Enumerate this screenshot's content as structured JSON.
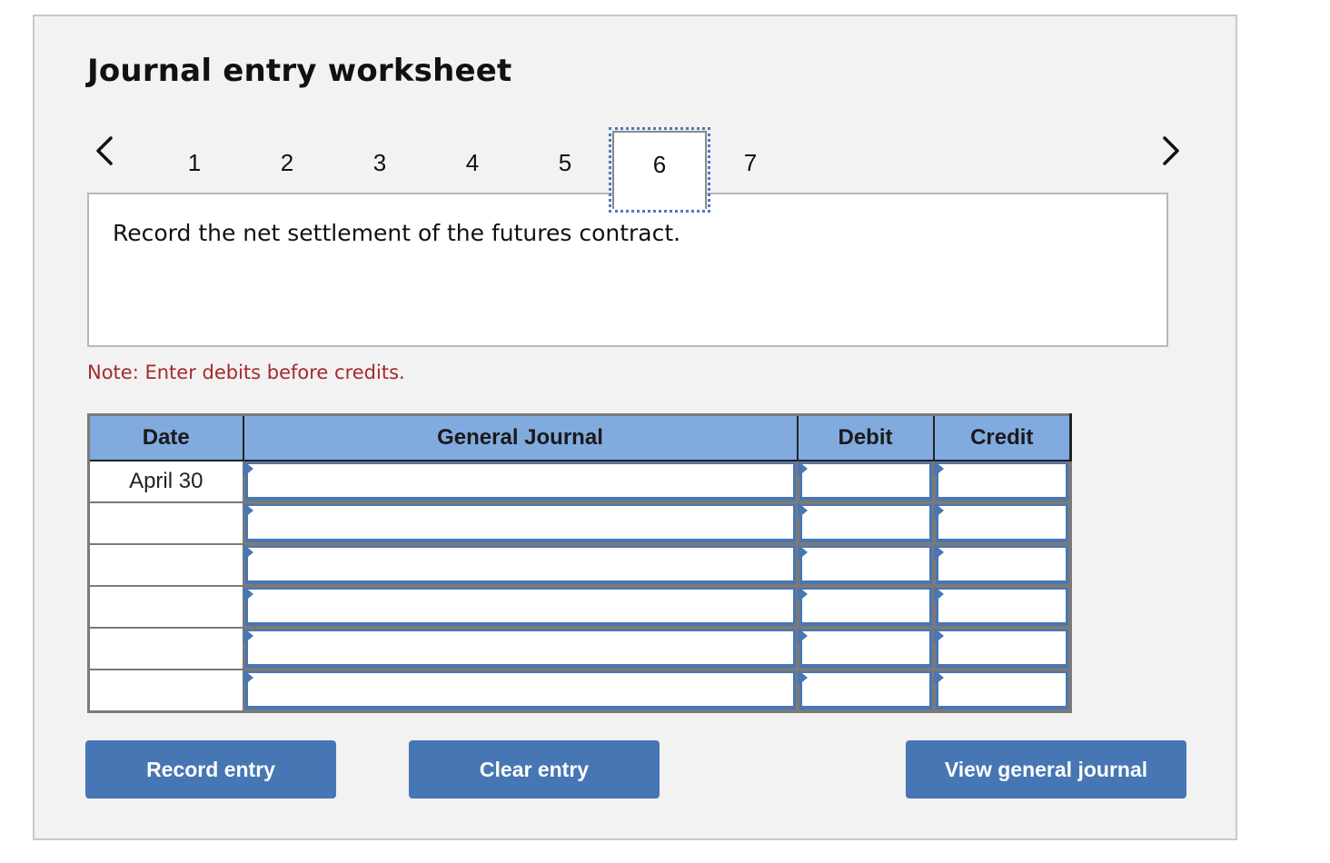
{
  "worksheet": {
    "title": "Journal entry worksheet",
    "navigation": {
      "prev_icon": "chevron-left-icon",
      "next_icon": "chevron-right-icon",
      "steps": [
        "1",
        "2",
        "3",
        "4",
        "5",
        "6",
        "7"
      ],
      "active_step": "6"
    },
    "prompt": "Record the net settlement of the futures contract.",
    "note": "Note: Enter debits before credits.",
    "table": {
      "columns": [
        "Date",
        "General Journal",
        "Debit",
        "Credit"
      ],
      "rows": [
        {
          "date": "April 30",
          "account": "",
          "debit": "",
          "credit": ""
        },
        {
          "date": "",
          "account": "",
          "debit": "",
          "credit": ""
        },
        {
          "date": "",
          "account": "",
          "debit": "",
          "credit": ""
        },
        {
          "date": "",
          "account": "",
          "debit": "",
          "credit": ""
        },
        {
          "date": "",
          "account": "",
          "debit": "",
          "credit": ""
        },
        {
          "date": "",
          "account": "",
          "debit": "",
          "credit": ""
        }
      ]
    },
    "buttons": {
      "record": "Record entry",
      "clear": "Clear entry",
      "view": "View general journal"
    },
    "colors": {
      "header_bg": "#81aadf",
      "button_bg": "#4776b4",
      "input_border": "#4a76b2",
      "note_text": "#a52a2a",
      "focus_outline": "#4a7ac0"
    }
  }
}
